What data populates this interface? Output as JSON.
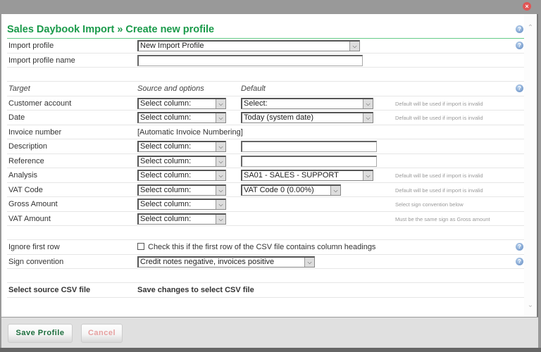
{
  "window": {
    "close_icon": "×",
    "scroll_up_icon": "^",
    "scroll_down_icon": "v"
  },
  "header": {
    "title": "Sales Daybook Import » Create new profile",
    "help_icon": "?"
  },
  "profile": {
    "import_profile_label": "Import profile",
    "import_profile_value": "New Import Profile",
    "import_profile_name_label": "Import profile name",
    "import_profile_name_value": ""
  },
  "columns": {
    "target": "Target",
    "source": "Source and options",
    "default": "Default"
  },
  "fields": [
    {
      "target": "Customer account",
      "source": "Select column:",
      "default": "Select:",
      "note": "Default will be used if import is invalid"
    },
    {
      "target": "Date",
      "source": "Select column:",
      "default": "Today (system date)",
      "note": "Default will be used if import is invalid"
    },
    {
      "target": "Invoice number",
      "source": "[Automatic Invoice Numbering]"
    },
    {
      "target": "Description",
      "source": "Select column:",
      "default": ""
    },
    {
      "target": "Reference",
      "source": "Select column:",
      "default": ""
    },
    {
      "target": "Analysis",
      "source": "Select column:",
      "default": "SA01 - SALES - SUPPORT",
      "note": "Default will be used if import is invalid"
    },
    {
      "target": "VAT Code",
      "source": "Select column:",
      "default": "VAT Code 0 (0.00%)",
      "note": "Default will be used if import is invalid"
    },
    {
      "target": "Gross Amount",
      "source": "Select column:",
      "note": "Select sign convention below"
    },
    {
      "target": "VAT Amount",
      "source": "Select column:",
      "note": "Must be the same sign as Gross amount"
    }
  ],
  "options": {
    "ignore_first_row_label": "Ignore first row",
    "ignore_first_row_text": "Check this if the first row of the CSV file contains column headings",
    "ignore_first_row_checked": false,
    "sign_convention_label": "Sign convention",
    "sign_convention_value": "Credit notes negative, invoices positive"
  },
  "csv": {
    "label": "Select source CSV file",
    "text": "Save changes to select CSV file"
  },
  "footer": {
    "save_label": "Save Profile",
    "cancel_label": "Cancel"
  },
  "colors": {
    "title_green": "#1a9a4a",
    "save_text": "#1b6d3c",
    "cancel_text": "#e6a0a0",
    "close_red": "#e05555"
  }
}
